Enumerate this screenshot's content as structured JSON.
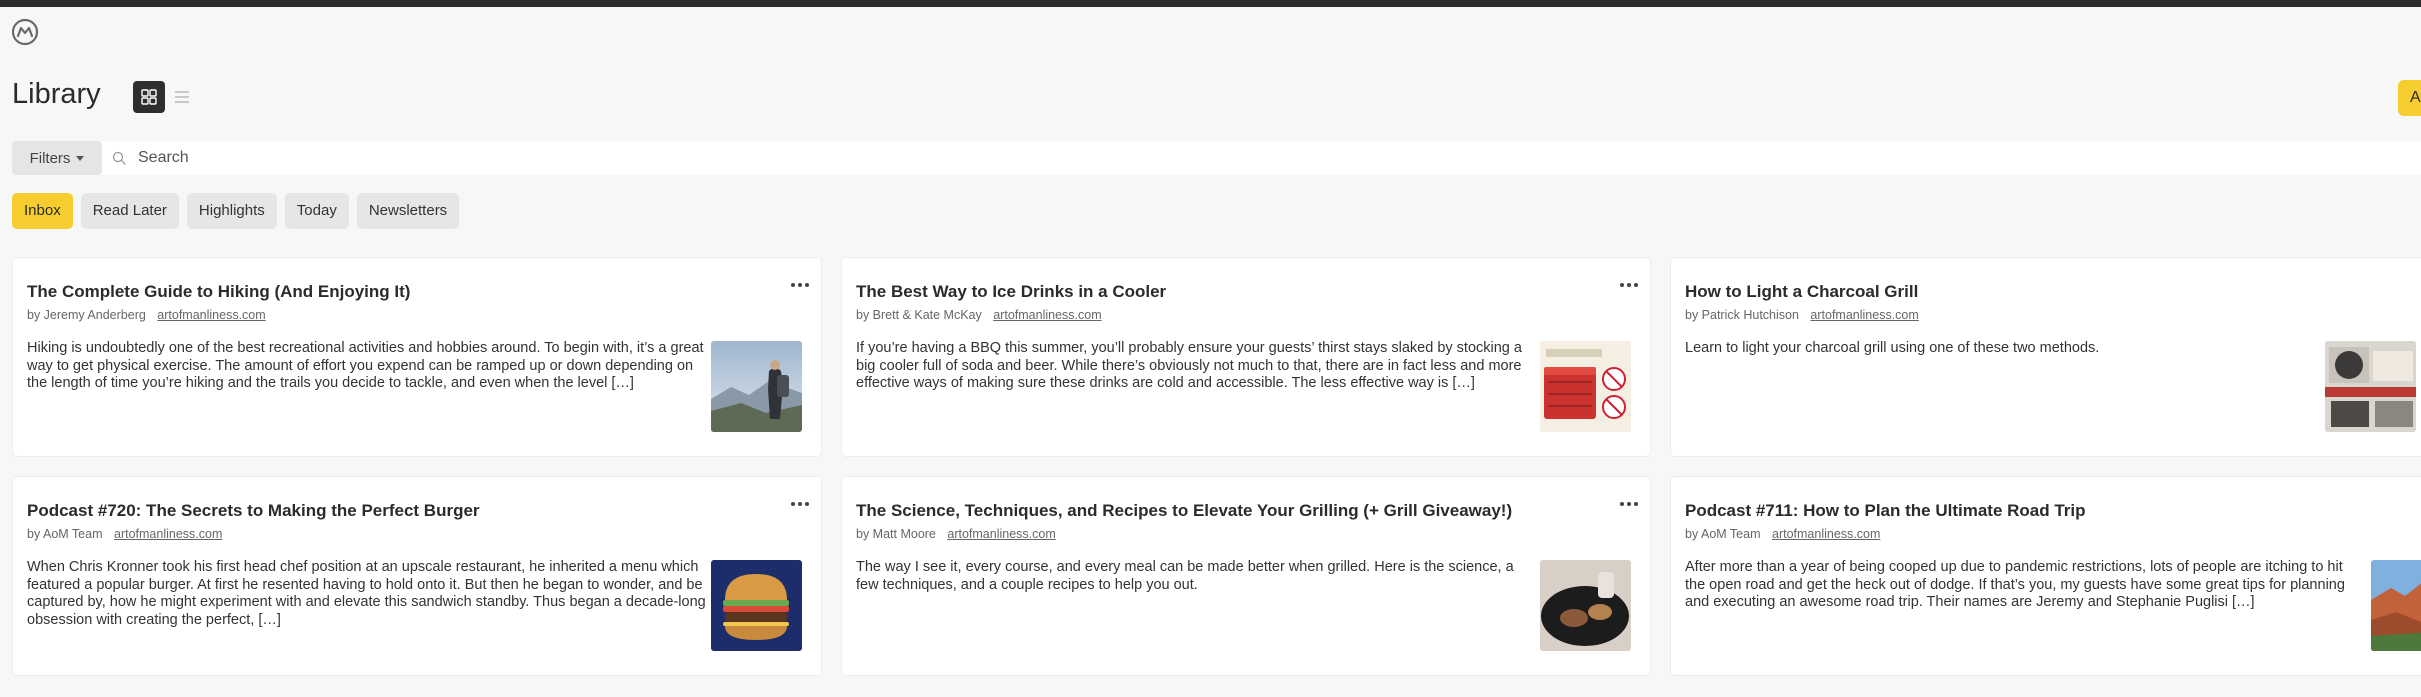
{
  "app": {
    "logo": "omnivore-logo-icon"
  },
  "library": {
    "title": "Library"
  },
  "header": {
    "add_label": "A"
  },
  "search": {
    "filters_label": "Filters",
    "placeholder": "Search"
  },
  "tabs": [
    {
      "label": "Inbox",
      "active": true
    },
    {
      "label": "Read Later",
      "active": false
    },
    {
      "label": "Highlights",
      "active": false
    },
    {
      "label": "Today",
      "active": false
    },
    {
      "label": "Newsletters",
      "active": false
    }
  ],
  "cards": [
    {
      "title": "The Complete Guide to Hiking (And Enjoying It)",
      "author": "by Jeremy Anderberg",
      "domain": "artofmanliness.com",
      "excerpt": "Hiking is undoubtedly one of the best recreational activities and hobbies around.  To begin with, it’s a great way to get physical exercise. The amount of effort you expend can be ramped up or down depending on the length of time you’re hiking and the trails you decide to tackle, and even when the level […]",
      "thumb": "hiker-image"
    },
    {
      "title": "The Best Way to Ice Drinks in a Cooler",
      "author": "by Brett & Kate McKay",
      "domain": "artofmanliness.com",
      "excerpt": "If you’re having a BBQ this summer, you’ll probably ensure your guests’ thirst stays slaked by stocking a big cooler full of soda and beer. While there’s obviously not much to that, there are in fact less and more effective ways of making sure these drinks are cold and accessible. The less effective way is […]",
      "thumb": "cooler-image"
    },
    {
      "title": "How to Light a Charcoal Grill",
      "author": "by Patrick Hutchison",
      "domain": "artofmanliness.com",
      "excerpt": "Learn to light your charcoal grill using one of these two methods.",
      "thumb": "charcoal-image"
    },
    {
      "title": "Podcast #720: The Secrets to Making the Perfect Burger",
      "author": "by AoM Team",
      "domain": "artofmanliness.com",
      "excerpt": "When Chris Kronner took his first head chef position at an upscale restaurant, he inherited a menu which featured a popular burger. At first he resented having to hold onto it. But then he began to wonder, and be captured by, how he might experiment with and elevate this sandwich standby. Thus began a decade-long obsession with creating the perfect, […]",
      "thumb": "burger-image"
    },
    {
      "title": "The Science, Techniques, and Recipes to Elevate Your Grilling (+ Grill Giveaway!)",
      "author": "by Matt Moore",
      "domain": "artofmanliness.com",
      "excerpt": "The way I see it, every course, and every meal can be made better when grilled. Here is the science, a few techniques, and a couple recipes to help you out.",
      "thumb": "grill-image"
    },
    {
      "title": "Podcast #711: How to Plan the Ultimate Road Trip",
      "author": "by AoM Team",
      "domain": "artofmanliness.com",
      "excerpt": "After more than a year of being cooped up due to pandemic restrictions, lots of people are itching to hit the open road and get the heck out of dodge. If that’s you, my guests have some great tips for planning and executing an awesome road trip. Their names are Jeremy and Stephanie Puglisi […]",
      "thumb": "canyon-image"
    }
  ],
  "colors": {
    "accent": "#f5cd2f",
    "topbar": "#2c2c2c",
    "background": "#f7f7f7"
  }
}
